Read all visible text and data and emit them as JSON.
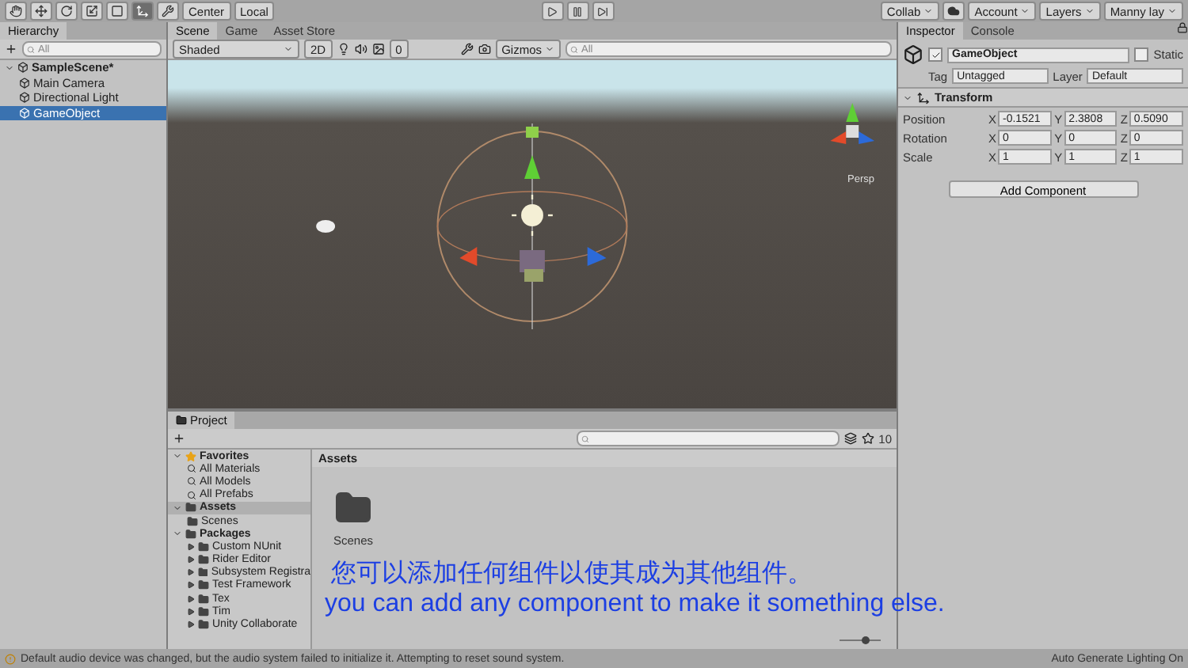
{
  "toolbar": {
    "tools": [
      {
        "kind": "hand",
        "selected": false
      },
      {
        "kind": "move",
        "selected": false
      },
      {
        "kind": "rotate",
        "selected": false
      },
      {
        "kind": "scale",
        "selected": false
      },
      {
        "kind": "rect",
        "selected": false
      },
      {
        "kind": "transform",
        "selected": true
      },
      {
        "kind": "custom",
        "selected": false
      }
    ],
    "pivot_buttons": [
      "Center",
      "Local"
    ],
    "right_buttons": [
      "Collab",
      "Account",
      "Layers",
      "Manny lay"
    ]
  },
  "hierarchy": {
    "title": "Hierarchy",
    "search_placeholder": "All",
    "tree": [
      {
        "label": "SampleScene*",
        "expanded": true,
        "selected": false,
        "children": [
          {
            "label": "Main Camera",
            "selected": false
          },
          {
            "label": "Directional Light",
            "selected": false
          },
          {
            "label": "GameObject",
            "selected": true
          }
        ]
      }
    ]
  },
  "scene": {
    "tabs": [
      {
        "label": "Scene",
        "selected": true
      },
      {
        "label": "Game",
        "selected": false
      },
      {
        "label": "Asset Store",
        "selected": false
      }
    ],
    "shading": "Shaded",
    "mode_2d": "2D",
    "hidden_count": "0",
    "gizmos": "Gizmos",
    "search_placeholder": "All",
    "projection": "Persp"
  },
  "inspector": {
    "tabs": [
      {
        "label": "Inspector",
        "selected": true
      },
      {
        "label": "Console",
        "selected": false
      }
    ],
    "object_name": "GameObject",
    "active": true,
    "static_label": "Static",
    "static": false,
    "tag_label": "Tag",
    "tag": "Untagged",
    "layer_label": "Layer",
    "layer": "Default",
    "component": {
      "name": "Transform",
      "expanded": true,
      "rows": [
        {
          "label": "Position",
          "fields": [
            {
              "axis": "X",
              "value": "-0.1521"
            },
            {
              "axis": "Y",
              "value": "2.3808"
            },
            {
              "axis": "Z",
              "value": "0.5090"
            }
          ]
        },
        {
          "label": "Rotation",
          "fields": [
            {
              "axis": "X",
              "value": "0"
            },
            {
              "axis": "Y",
              "value": "0"
            },
            {
              "axis": "Z",
              "value": "0"
            }
          ]
        },
        {
          "label": "Scale",
          "fields": [
            {
              "axis": "X",
              "value": "1"
            },
            {
              "axis": "Y",
              "value": "1"
            },
            {
              "axis": "Z",
              "value": "1"
            }
          ]
        }
      ]
    },
    "add_button": "Add Component"
  },
  "project": {
    "tab": "Project",
    "count": "10",
    "tree": [
      {
        "label": "Favorites",
        "kind": "favorites",
        "expanded": true,
        "selected": false,
        "children": [
          {
            "label": "All Materials",
            "kind": "search"
          },
          {
            "label": "All Models",
            "kind": "search"
          },
          {
            "label": "All Prefabs",
            "kind": "search"
          }
        ]
      },
      {
        "label": "Assets",
        "kind": "folder",
        "expanded": true,
        "selected": true,
        "children": [
          {
            "label": "Scenes",
            "kind": "folder"
          }
        ]
      },
      {
        "label": "Packages",
        "kind": "folder",
        "expanded": true,
        "selected": false,
        "children": [
          {
            "label": "Custom NUnit",
            "kind": "folder",
            "expanded": false
          },
          {
            "label": "Rider Editor",
            "kind": "folder",
            "expanded": false
          },
          {
            "label": "Subsystem Registra",
            "kind": "folder",
            "expanded": false
          },
          {
            "label": "Test Framework",
            "kind": "folder",
            "expanded": false
          },
          {
            "label": "Tex",
            "kind": "folder",
            "expanded": false
          },
          {
            "label": "Tim",
            "kind": "folder",
            "expanded": false
          },
          {
            "label": "Unity Collaborate",
            "kind": "folder",
            "expanded": false
          }
        ]
      }
    ],
    "breadcrumb": "Assets",
    "zoom_slider": {
      "level": 0.6
    },
    "items": [
      {
        "label": "Scenes"
      }
    ]
  },
  "captions": {
    "zh": "您可以添加任何组件以使其成为其他组件。",
    "en": "you can add any component to make it something else."
  },
  "status_bar": {
    "message": "Default audio device was changed, but the audio system failed to initialize it. Attempting to reset sound system.",
    "lighting": "Auto Generate Lighting On"
  }
}
